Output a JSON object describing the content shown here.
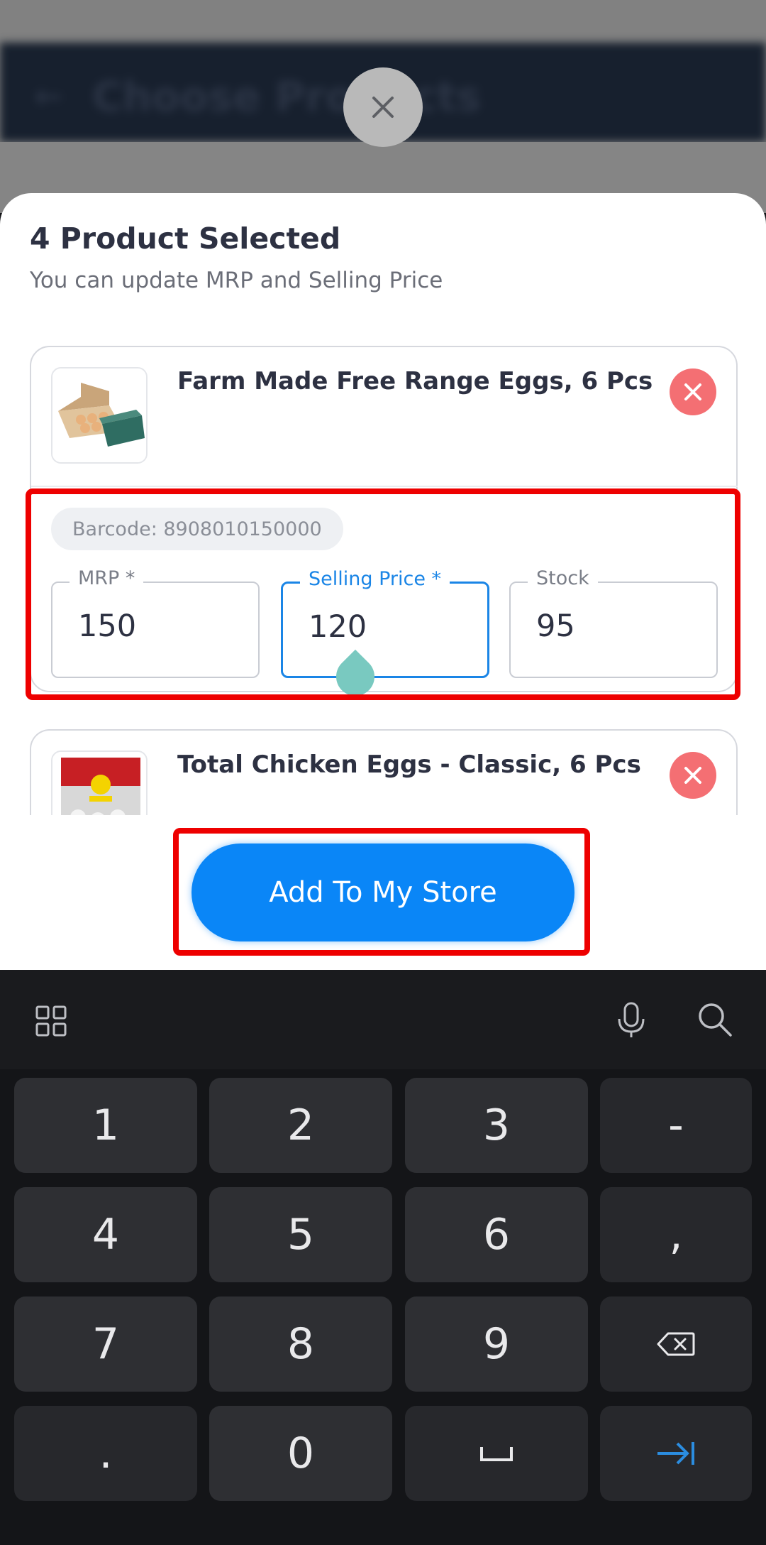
{
  "background_app": {
    "title": "Choose Products"
  },
  "sheet": {
    "title": "4 Product Selected",
    "subtitle": "You can update MRP and Selling Price"
  },
  "products": [
    {
      "name": "Farm Made Free Range Eggs, 6 Pcs",
      "barcode": "Barcode: 8908010150000",
      "fields": {
        "mrp_label": "MRP *",
        "mrp_value": "150",
        "selling_label": "Selling Price *",
        "selling_value": "120",
        "stock_label": "Stock",
        "stock_value": "95"
      }
    },
    {
      "name": "Total Chicken Eggs - Classic, 6 Pcs"
    }
  ],
  "primary_button": "Add To My Store",
  "keyboard": {
    "toolbar_icons": [
      "apps-grid-icon",
      "microphone-icon",
      "search-icon"
    ],
    "keys": [
      "1",
      "2",
      "3",
      "-",
      "4",
      "5",
      "6",
      ",",
      "7",
      "8",
      "9",
      "backspace",
      ".",
      "0",
      "space",
      "next"
    ]
  },
  "colors": {
    "accent": "#0a86f7",
    "remove": "#f46f73",
    "highlight": "#ee0000",
    "sheet_title": "#2d3142"
  }
}
